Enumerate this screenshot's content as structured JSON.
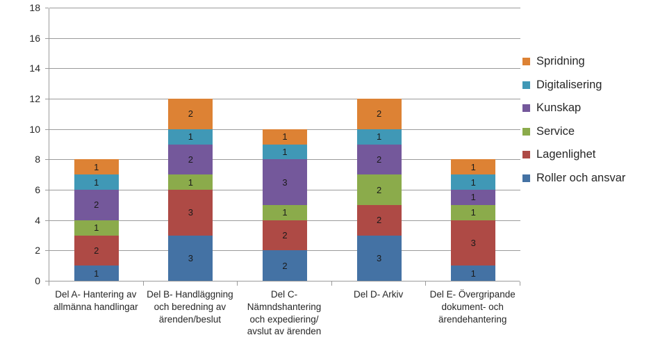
{
  "chart_data": {
    "type": "bar",
    "subtype": "stacked-column",
    "title": "",
    "xlabel": "",
    "ylabel": "",
    "ylim": [
      0,
      18
    ],
    "ytick_step": 2,
    "yticks": [
      "0",
      "2",
      "4",
      "6",
      "8",
      "10",
      "12",
      "14",
      "16",
      "18"
    ],
    "grid": "horizontal",
    "legend_position": "right",
    "categories": [
      "Del A- Hantering av allmänna handlingar",
      "Del B- Handläggning och beredning av ärenden/beslut",
      "Del C- Nämndshantering och expediering/ avslut av ärenden",
      "Del D- Arkiv",
      "Del E- Övergripande dokument- och ärendehantering"
    ],
    "category_lines": [
      [
        "Del A- Hantering av",
        "allmänna handlingar"
      ],
      [
        "Del B- Handläggning",
        "och beredning av",
        "ärenden/beslut"
      ],
      [
        "Del C-",
        "Nämndshantering",
        "och expediering/",
        "avslut av ärenden"
      ],
      [
        "Del D- Arkiv"
      ],
      [
        "Del E- Övergripande",
        "dokument- och",
        "ärendehantering"
      ]
    ],
    "series": [
      {
        "name": "Roller och ansvar",
        "color": "#4472A4",
        "values": [
          1,
          3,
          2,
          3,
          1
        ]
      },
      {
        "name": "Lagenlighet",
        "color": "#AE4A45",
        "values": [
          2,
          3,
          2,
          2,
          3
        ]
      },
      {
        "name": "Service",
        "color": "#8BAB4B",
        "values": [
          1,
          1,
          1,
          2,
          1
        ]
      },
      {
        "name": "Kunskap",
        "color": "#74589B",
        "values": [
          2,
          2,
          3,
          2,
          1
        ]
      },
      {
        "name": "Digitalisering",
        "color": "#4098B6",
        "values": [
          1,
          1,
          1,
          1,
          1
        ]
      },
      {
        "name": "Spridning",
        "color": "#DD8234",
        "values": [
          1,
          2,
          1,
          2,
          1
        ]
      }
    ],
    "totals": [
      8,
      12,
      10,
      12,
      8
    ],
    "legend_order_top_to_bottom": [
      "Spridning",
      "Digitalisering",
      "Kunskap",
      "Service",
      "Lagenlighet",
      "Roller och ansvar"
    ]
  }
}
